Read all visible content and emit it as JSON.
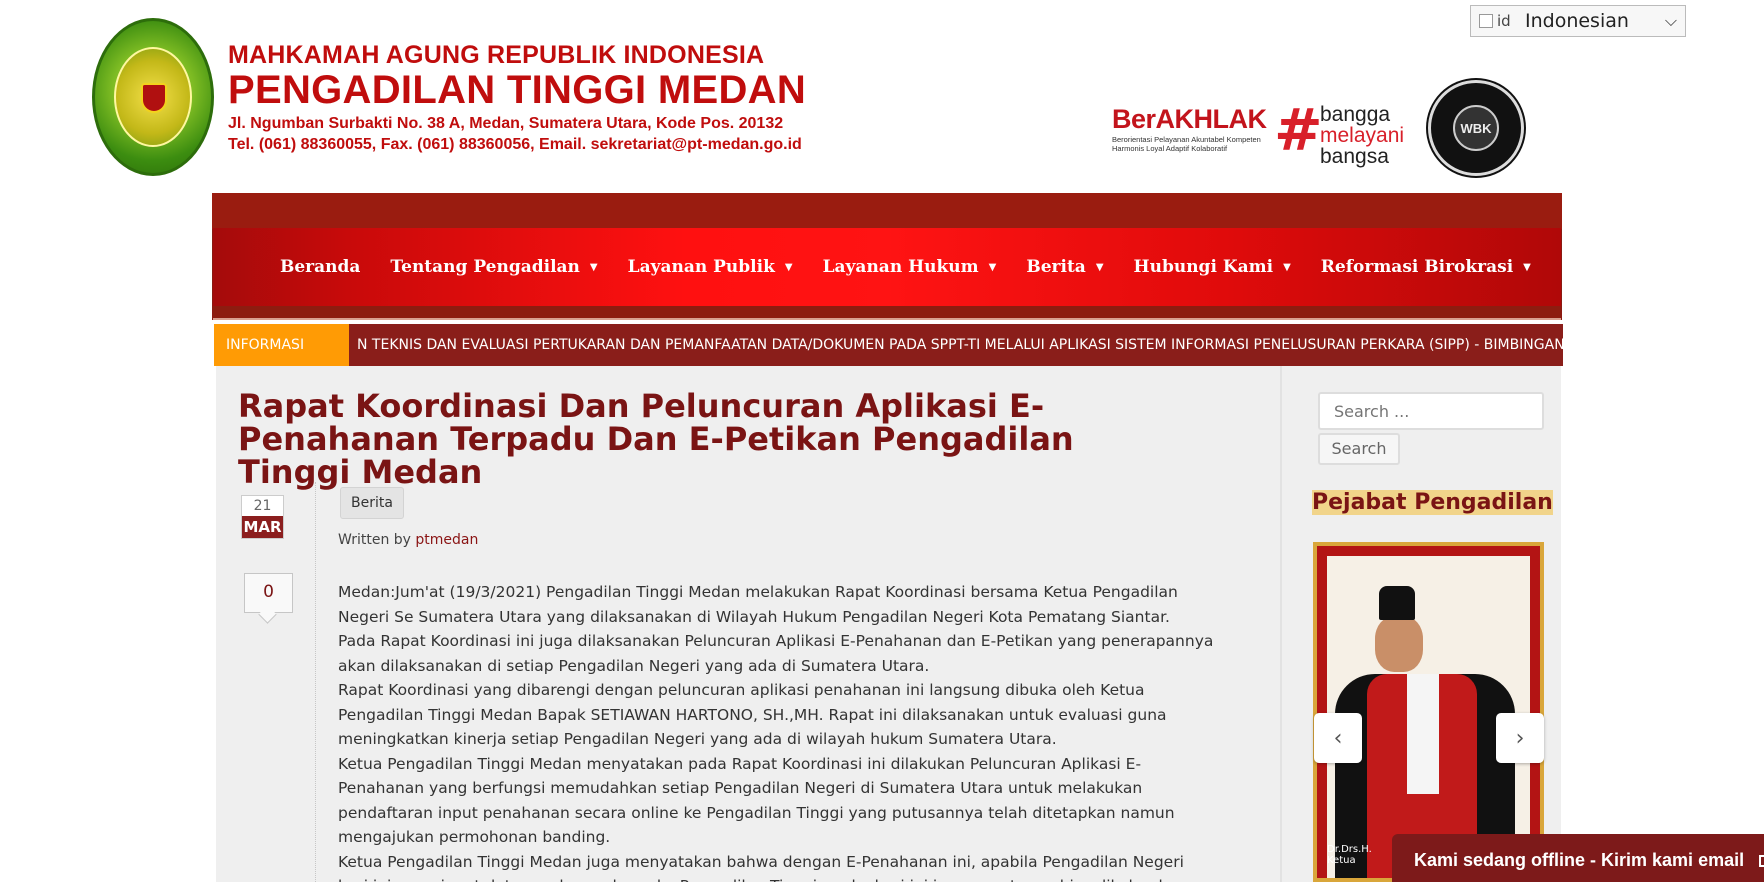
{
  "language": {
    "flag_alt": "id",
    "selected": "Indonesian"
  },
  "header": {
    "line1": "MAHKAMAH AGUNG REPUBLIK INDONESIA",
    "line2": "PENGADILAN TINGGI MEDAN",
    "line3": "Jl. Ngumban Surbakti No. 38 A, Medan, Sumatera Utara, Kode Pos. 20132",
    "line4": "Tel. (061) 88360055, Fax. (061) 88360056, Email. sekretariat@pt-medan.go.id",
    "berakhlak": "BerAKHLAK",
    "berakhlak_sub1": "Berorientasi Pelayanan Akuntabel Kompeten",
    "berakhlak_sub2": "Harmonis Loyal Adaptif Kolaboratif",
    "hashtag": "#",
    "bangga1": "bangga",
    "bangga2": "melayani",
    "bangga3": "bangsa",
    "wbk": "WBK"
  },
  "nav": {
    "items": [
      {
        "label": "Beranda",
        "caret": ""
      },
      {
        "label": "Tentang Pengadilan",
        "caret": "▼"
      },
      {
        "label": "Layanan Publik",
        "caret": "▼"
      },
      {
        "label": "Layanan Hukum",
        "caret": "▼"
      },
      {
        "label": "Berita",
        "caret": "▼"
      },
      {
        "label": "Hubungi Kami",
        "caret": "▼"
      },
      {
        "label": "Reformasi Birokrasi",
        "caret": "▼"
      }
    ]
  },
  "ticker": {
    "label": "INFORMASI",
    "text": "N TEKNIS DAN EVALUASI PERTUKARAN DAN PEMANFAATAN DATA/DOKUMEN PADA SPPT-TI MELALUI APLIKASI SISTEM INFORMASI PENELUSURAN PERKARA (SIPP)   -   BIMBINGAN TEKNIS ASN"
  },
  "article": {
    "title": "Rapat Koordinasi Dan Peluncuran Aplikasi E-Penahanan Terpadu Dan E-Petikan Pengadilan Tinggi Medan",
    "day": "21",
    "month": "MAR",
    "comments": "0",
    "category": "Berita",
    "written_by": "Written by",
    "author": "ptmedan",
    "paragraphs": [
      "Medan:Jum'at (19/3/2021) Pengadilan Tinggi Medan melakukan Rapat Koordinasi bersama Ketua Pengadilan Negeri Se Sumatera Utara yang dilaksanakan di Wilayah Hukum Pengadilan Negeri Kota Pematang Siantar.",
      "Pada Rapat Koordinasi ini juga dilaksanakan Peluncuran Aplikasi E-Penahanan dan E-Petikan yang penerapannya akan dilaksanakan di setiap Pengadilan Negeri yang ada di Sumatera Utara.",
      "Rapat Koordinasi yang dibarengi dengan peluncuran aplikasi penahanan ini langsung dibuka oleh Ketua Pengadilan Tinggi Medan Bapak SETIAWAN HARTONO, SH.,MH. Rapat ini dilaksanakan untuk evaluasi guna meningkatkan kinerja setiap Pengadilan Negeri yang ada di wilayah hukum Sumatera Utara.",
      "Ketua Pengadilan Tinggi Medan menyatakan pada Rapat Koordinasi ini dilakukan Peluncuran Aplikasi E-Penahanan yang berfungsi memudahkan setiap Pengadilan Negeri di Sumatera Utara untuk melakukan pendaftaran input penahanan secara online ke Pengadilan Tinggi yang putusannya telah ditetapkan namun mengajukan permohonan banding.",
      "Ketua Pengadilan Tinggi Medan juga menyatakan bahwa dengan E-Penahanan ini, apabila Pengadilan Negeri hari ini menginput datanya dan melapor ke Pengadilan Tinggi, maka hari ini juga penetapan bisa dikeluarkan oleh Pengadilan"
    ]
  },
  "sidebar": {
    "search_placeholder": "Search ...",
    "search_button": "Search",
    "heading": "Pejabat Pengadilan",
    "photo_caption": "Dr.Drs.H.",
    "photo_caption2": "Ketua",
    "prev": "‹",
    "next": "›"
  },
  "chat": {
    "label": "Kami sedang offline - Kirim kami email"
  }
}
